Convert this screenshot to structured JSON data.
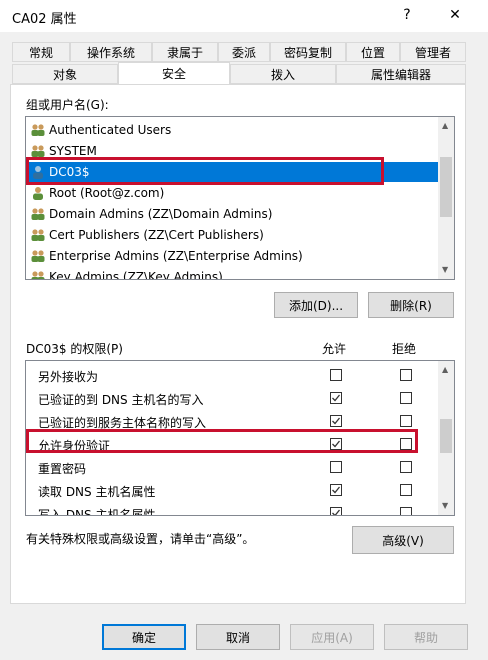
{
  "window": {
    "title": "CA02 属性",
    "help_glyph": "?",
    "close_glyph": "✕"
  },
  "tabs_row1": [
    "常规",
    "操作系统",
    "隶属于",
    "委派",
    "密码复制",
    "位置",
    "管理者"
  ],
  "tabs_row2": [
    "对象",
    "安全",
    "拨入",
    "属性编辑器"
  ],
  "active_tab": "安全",
  "groups": {
    "label": "组或用户名(G):",
    "items": [
      {
        "label": "Authenticated Users",
        "icon": "group-icon"
      },
      {
        "label": "SYSTEM",
        "icon": "group-icon"
      },
      {
        "label": "DC03$",
        "icon": "computer-user-icon",
        "selected": true
      },
      {
        "label": "Root (Root@z.com)",
        "icon": "user-icon"
      },
      {
        "label": "Domain Admins (ZZ\\Domain Admins)",
        "icon": "group-icon"
      },
      {
        "label": "Cert Publishers (ZZ\\Cert Publishers)",
        "icon": "group-icon"
      },
      {
        "label": "Enterprise Admins (ZZ\\Enterprise Admins)",
        "icon": "group-icon"
      },
      {
        "label": "Key Admins (ZZ\\Key Admins)",
        "icon": "group-icon"
      }
    ],
    "add_label": "添加(D)...",
    "remove_label": "删除(R)"
  },
  "permissions": {
    "label": "DC03$ 的权限(P)",
    "allow_header": "允许",
    "deny_header": "拒绝",
    "rows": [
      {
        "label": "另外接收为",
        "allow": false,
        "deny": false
      },
      {
        "label": "已验证的到 DNS 主机名的写入",
        "allow": true,
        "deny": false
      },
      {
        "label": "已验证的到服务主体名称的写入",
        "allow": true,
        "deny": false
      },
      {
        "label": "允许身份验证",
        "allow": true,
        "deny": false
      },
      {
        "label": "重置密码",
        "allow": false,
        "deny": false
      },
      {
        "label": "读取 DNS 主机名属性",
        "allow": true,
        "deny": false
      },
      {
        "label": "写入 DNS 主机名属性",
        "allow": true,
        "deny": false
      }
    ]
  },
  "advanced": {
    "note": "有关特殊权限或高级设置，请单击“高级”。",
    "button": "高级(V)"
  },
  "footer": {
    "ok": "确定",
    "cancel": "取消",
    "apply": "应用(A)",
    "help": "帮助"
  },
  "colors": {
    "selection": "#0078d7",
    "highlight_box": "#c8102e",
    "check": "#333333"
  }
}
